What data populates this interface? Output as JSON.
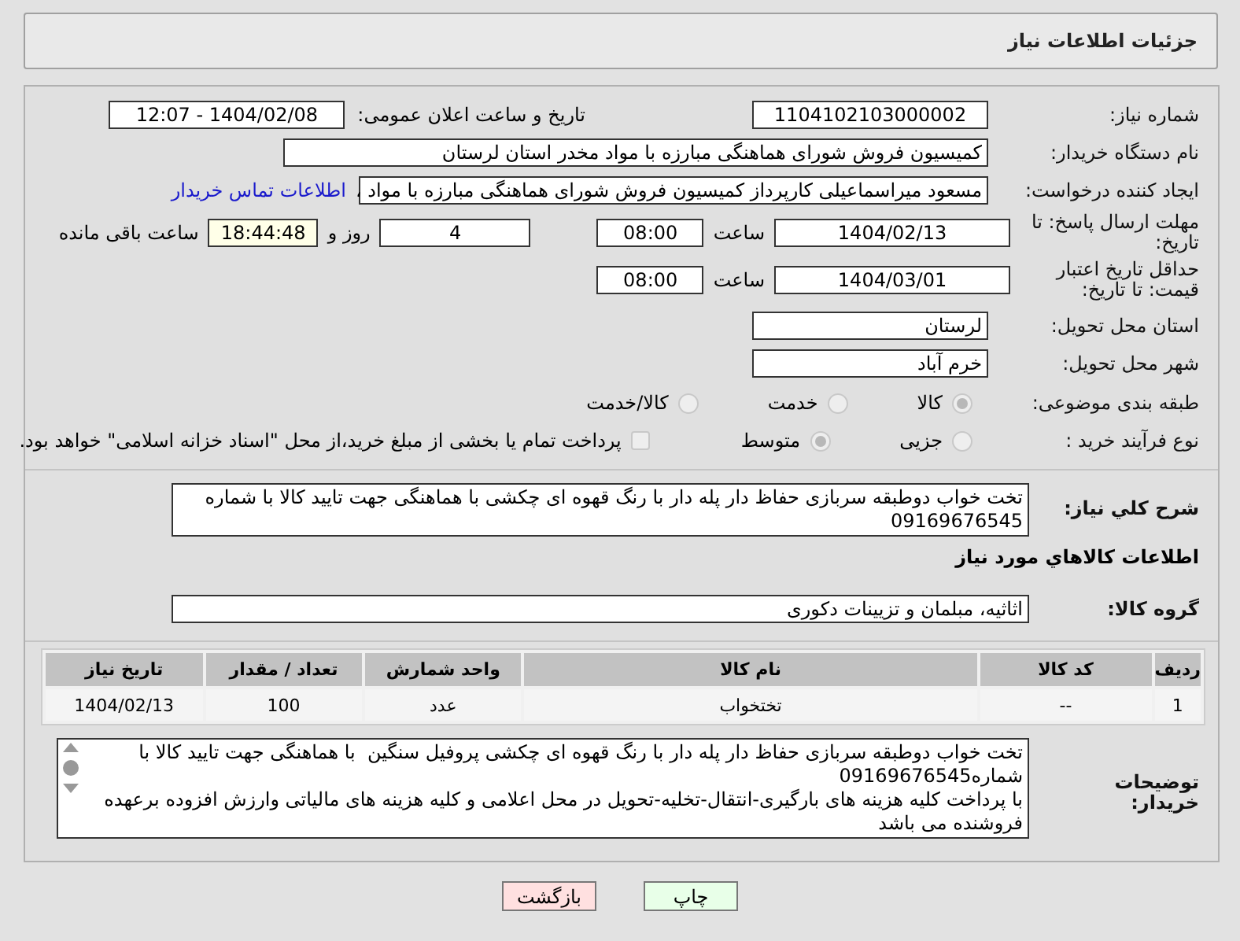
{
  "header": {
    "title": "جزئیات اطلاعات نیاز"
  },
  "need_number": {
    "label": "شماره نیاز:",
    "value": "1104102103000002"
  },
  "announce": {
    "label": "تاریخ و ساعت اعلان عمومی:",
    "value": "1404/02/08 - 12:07"
  },
  "buyer_org": {
    "label": "نام دستگاه خریدار:",
    "value": "کمیسیون فروش شورای هماهنگی مبارزه با مواد مخدر استان لرستان"
  },
  "requester": {
    "label": "ایجاد کننده درخواست:",
    "value": "مسعود میراسماعیلی کارپرداز کمیسیون فروش شورای هماهنگی مبارزه با مواد ،",
    "contact_link": "اطلاعات تماس خریدار"
  },
  "deadline": {
    "label": "مهلت ارسال پاسخ: تا تاریخ:",
    "date": "1404/02/13",
    "time_label": "ساعت",
    "time": "08:00",
    "days": "4",
    "days_label": "روز و",
    "remaining": "18:44:48",
    "remaining_label": "ساعت باقی مانده"
  },
  "validity": {
    "label": "حداقل تاریخ اعتبار قیمت: تا تاریخ:",
    "date": "1404/03/01",
    "time_label": "ساعت",
    "time": "08:00"
  },
  "province": {
    "label": "استان محل تحویل:",
    "value": "لرستان"
  },
  "city": {
    "label": "شهر محل تحویل:",
    "value": "خرم آباد"
  },
  "category": {
    "label": "طبقه بندی موضوعی:",
    "options": [
      {
        "label": "کالا",
        "selected": true
      },
      {
        "label": "خدمت",
        "selected": false
      },
      {
        "label": "کالا/خدمت",
        "selected": false
      }
    ]
  },
  "process": {
    "label": "نوع فرآیند خرید :",
    "options": [
      {
        "label": "جزیی",
        "selected": false
      },
      {
        "label": "متوسط",
        "selected": true
      }
    ],
    "payment_note": {
      "text": "پرداخت تمام یا بخشی از مبلغ خرید،از محل \"اسناد خزانه اسلامی\" خواهد بود.",
      "checked": false
    }
  },
  "description": {
    "label": "شرح کلي نياز:",
    "value": "تخت خواب دوطبقه سربازی حفاظ دار پله دار با رنگ قهوه ای چکشی با هماهنگی جهت تایید کالا با شماره 09169676545"
  },
  "goods_title": "اطلاعات کالاهاي مورد نياز",
  "goods_group": {
    "label": "گروه کالا:",
    "value": "اثاثیه، مبلمان و تزیینات دکوری"
  },
  "table": {
    "columns": [
      "ردیف",
      "کد کالا",
      "نام کالا",
      "واحد شمارش",
      "تعداد / مقدار",
      "تاریخ نیاز"
    ],
    "rows": [
      [
        "1",
        "--",
        "تختخواب",
        "عدد",
        "100",
        "1404/02/13"
      ]
    ]
  },
  "buyer_notes": {
    "label": "توضیحات خریدار:",
    "value": "تخت خواب دوطبقه سربازی حفاظ دار پله دار با رنگ قهوه ای چکشی پروفیل سنگین  با هماهنگی جهت تایید کالا با شماره09169676545\nبا پرداخت کلیه هزینه های بارگیری-انتقال-تخلیه-تحویل در محل اعلامی و کلیه هزینه های مالیاتی وارزش افزوده برعهده فروشنده می باشد"
  },
  "buttons": [
    {
      "label": "چاپ",
      "kind": "print"
    },
    {
      "label": "بازگشت",
      "kind": "back"
    }
  ]
}
